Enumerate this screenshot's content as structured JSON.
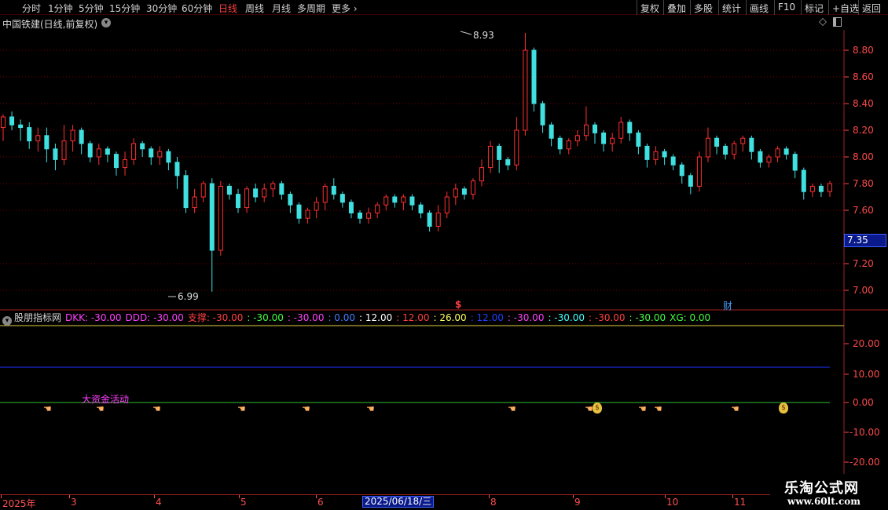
{
  "toolbar": {
    "periods": [
      "分时",
      "1分钟",
      "5分钟",
      "15分钟",
      "30分钟",
      "60分钟",
      "日线",
      "周线",
      "月线",
      "多周期",
      "更多"
    ],
    "active_period": "日线",
    "right_buttons": [
      "复权",
      "叠加",
      "多股",
      "统计",
      "画线",
      "F10",
      "标记",
      "+自选",
      "返回"
    ]
  },
  "stock": {
    "title": "中国铁建(日线,前复权)"
  },
  "price_axis": {
    "ticks": [
      "8.80",
      "8.60",
      "8.40",
      "8.20",
      "8.00",
      "7.80",
      "7.60",
      "7.20",
      "7.00"
    ],
    "current_price": "7.35"
  },
  "annotations": {
    "high": "8.93",
    "low": "6.99",
    "marker_dollar": "$",
    "marker_cai": "财",
    "big_money": "大资金活动"
  },
  "indicator": {
    "name": "股朋指标网",
    "items": [
      {
        "text": "DKK: -30.00",
        "color": "#ff40ff"
      },
      {
        "text": "DDD: -30.00",
        "color": "#ff40ff"
      },
      {
        "text": "支撑: -30.00",
        "color": "#ff4040"
      },
      {
        "text": ": -30.00",
        "color": "#40ff40"
      },
      {
        "text": ": -30.00",
        "color": "#ff40ff"
      },
      {
        "text": ": 0.00",
        "color": "#4080ff"
      },
      {
        "text": ": 12.00",
        "color": "#ffffff"
      },
      {
        "text": ": 12.00",
        "color": "#ff4040"
      },
      {
        "text": ": 26.00",
        "color": "#ffff60"
      },
      {
        "text": ": 12.00",
        "color": "#2040ff"
      },
      {
        "text": ": -30.00",
        "color": "#ff40ff"
      },
      {
        "text": ": -30.00",
        "color": "#40ffff"
      },
      {
        "text": ": -30.00",
        "color": "#ff4040"
      },
      {
        "text": ": -30.00",
        "color": "#40ff40"
      },
      {
        "text": "XG: 0.00",
        "color": "#40ff40"
      }
    ],
    "axis_ticks": [
      "20.00",
      "10.00",
      "0.00",
      "-10.00",
      "-20.00"
    ]
  },
  "date_axis": {
    "labels": [
      "2025年",
      "3",
      "4",
      "5",
      "6",
      "8",
      "9",
      "10",
      "11"
    ],
    "selected": "2025/06/18/三"
  },
  "watermark": {
    "title": "乐淘公式网",
    "url": "www.60lt.com"
  },
  "colors": {
    "up": "#ff3030",
    "down": "#40e0e0",
    "grid": "#7a0000",
    "axis": "#ff4a4a",
    "line_yellow": "#e0d040",
    "line_blue": "#2030ff",
    "line_green": "#30c030"
  },
  "chart_data": {
    "type": "candlestick",
    "ylim": [
      6.9,
      9.0
    ],
    "points": [
      [
        8.22,
        8.3,
        8.2,
        8.32,
        8.12
      ],
      [
        8.3,
        8.24,
        8.2,
        8.34,
        8.2
      ],
      [
        8.24,
        8.22,
        8.16,
        8.28,
        8.12
      ],
      [
        8.22,
        8.12,
        8.1,
        8.26,
        8.06
      ],
      [
        8.12,
        8.16,
        8.08,
        8.22,
        8.04
      ],
      [
        8.16,
        8.06,
        8.0,
        8.22,
        7.96
      ],
      [
        8.06,
        7.98,
        7.92,
        8.1,
        7.9
      ],
      [
        7.98,
        8.12,
        8.0,
        8.24,
        7.94
      ],
      [
        8.12,
        8.2,
        8.06,
        8.24,
        8.04
      ],
      [
        8.2,
        8.1,
        8.06,
        8.22,
        8.02
      ],
      [
        8.1,
        8.0,
        7.98,
        8.12,
        7.96
      ],
      [
        8.0,
        8.06,
        7.96,
        8.1,
        7.94
      ],
      [
        8.06,
        8.02,
        7.98,
        8.08,
        7.96
      ],
      [
        8.02,
        7.92,
        7.88,
        8.04,
        7.86
      ],
      [
        7.92,
        7.98,
        7.88,
        8.04,
        7.86
      ],
      [
        7.98,
        8.1,
        7.96,
        8.14,
        7.94
      ],
      [
        8.1,
        8.06,
        8.04,
        8.12,
        8.0
      ],
      [
        8.06,
        8.0,
        7.96,
        8.08,
        7.94
      ],
      [
        8.0,
        8.04,
        7.96,
        8.08,
        7.94
      ],
      [
        8.04,
        7.96,
        7.92,
        8.06,
        7.9
      ],
      [
        7.96,
        7.86,
        7.8,
        8.0,
        7.76
      ],
      [
        7.86,
        7.62,
        7.6,
        7.9,
        7.58
      ],
      [
        7.62,
        7.7,
        7.6,
        7.76,
        7.58
      ],
      [
        7.7,
        7.8,
        7.68,
        7.82,
        7.66
      ],
      [
        7.8,
        7.3,
        7.24,
        7.84,
        6.99
      ],
      [
        7.3,
        7.78,
        7.28,
        7.82,
        7.26
      ],
      [
        7.78,
        7.72,
        7.7,
        7.8,
        7.68
      ],
      [
        7.72,
        7.62,
        7.6,
        7.76,
        7.58
      ],
      [
        7.62,
        7.76,
        7.6,
        7.78,
        7.58
      ],
      [
        7.76,
        7.7,
        7.68,
        7.8,
        7.66
      ],
      [
        7.7,
        7.76,
        7.68,
        7.8,
        7.66
      ],
      [
        7.76,
        7.8,
        7.72,
        7.82,
        7.7
      ],
      [
        7.8,
        7.72,
        7.7,
        7.82,
        7.68
      ],
      [
        7.72,
        7.64,
        7.6,
        7.74,
        7.58
      ],
      [
        7.64,
        7.54,
        7.52,
        7.66,
        7.5
      ],
      [
        7.54,
        7.6,
        7.52,
        7.62,
        7.5
      ],
      [
        7.6,
        7.66,
        7.56,
        7.7,
        7.54
      ],
      [
        7.66,
        7.78,
        7.62,
        7.8,
        7.6
      ],
      [
        7.78,
        7.72,
        7.7,
        7.84,
        7.68
      ],
      [
        7.72,
        7.66,
        7.64,
        7.74,
        7.62
      ],
      [
        7.66,
        7.58,
        7.56,
        7.68,
        7.54
      ],
      [
        7.58,
        7.54,
        7.52,
        7.6,
        7.5
      ],
      [
        7.54,
        7.58,
        7.52,
        7.62,
        7.5
      ],
      [
        7.58,
        7.64,
        7.56,
        7.66,
        7.54
      ],
      [
        7.64,
        7.7,
        7.62,
        7.72,
        7.6
      ],
      [
        7.7,
        7.66,
        7.64,
        7.72,
        7.62
      ],
      [
        7.66,
        7.7,
        7.62,
        7.72,
        7.6
      ],
      [
        7.7,
        7.64,
        7.62,
        7.72,
        7.6
      ],
      [
        7.64,
        7.58,
        7.56,
        7.66,
        7.54
      ],
      [
        7.58,
        7.48,
        7.46,
        7.6,
        7.44
      ],
      [
        7.48,
        7.58,
        7.46,
        7.64,
        7.44
      ],
      [
        7.58,
        7.7,
        7.56,
        7.74,
        7.54
      ],
      [
        7.7,
        7.76,
        7.66,
        7.8,
        7.64
      ],
      [
        7.76,
        7.72,
        7.7,
        7.78,
        7.68
      ],
      [
        7.72,
        7.82,
        7.7,
        7.84,
        7.68
      ],
      [
        7.82,
        7.92,
        7.8,
        7.98,
        7.78
      ],
      [
        7.92,
        8.08,
        7.9,
        8.12,
        7.88
      ],
      [
        8.08,
        7.98,
        7.92,
        8.1,
        7.88
      ],
      [
        7.98,
        7.94,
        7.92,
        8.0,
        7.9
      ],
      [
        7.94,
        8.2,
        7.92,
        8.3,
        7.9
      ],
      [
        8.2,
        8.8,
        8.18,
        8.93,
        8.16
      ],
      [
        8.8,
        8.4,
        8.36,
        8.82,
        8.34
      ],
      [
        8.4,
        8.24,
        8.2,
        8.42,
        8.18
      ],
      [
        8.24,
        8.14,
        8.1,
        8.26,
        8.08
      ],
      [
        8.14,
        8.06,
        8.04,
        8.16,
        8.02
      ],
      [
        8.06,
        8.12,
        8.04,
        8.14,
        8.02
      ],
      [
        8.12,
        8.16,
        8.1,
        8.2,
        8.08
      ],
      [
        8.16,
        8.24,
        8.14,
        8.38,
        8.12
      ],
      [
        8.24,
        8.18,
        8.12,
        8.26,
        8.1
      ],
      [
        8.18,
        8.1,
        8.06,
        8.2,
        8.04
      ],
      [
        8.1,
        8.14,
        8.06,
        8.18,
        8.04
      ],
      [
        8.14,
        8.26,
        8.12,
        8.3,
        8.1
      ],
      [
        8.26,
        8.18,
        8.14,
        8.28,
        8.12
      ],
      [
        8.18,
        8.08,
        8.04,
        8.2,
        8.02
      ],
      [
        8.08,
        7.98,
        7.94,
        8.1,
        7.92
      ],
      [
        7.98,
        8.04,
        7.96,
        8.08,
        7.94
      ],
      [
        8.04,
        8.0,
        7.96,
        8.06,
        7.94
      ],
      [
        8.0,
        7.94,
        7.92,
        8.02,
        7.9
      ],
      [
        7.94,
        7.86,
        7.82,
        7.96,
        7.8
      ],
      [
        7.86,
        7.78,
        7.74,
        7.88,
        7.72
      ],
      [
        7.78,
        8.0,
        7.76,
        8.04,
        7.74
      ],
      [
        8.0,
        8.14,
        7.98,
        8.22,
        7.96
      ],
      [
        8.14,
        8.08,
        8.04,
        8.16,
        8.02
      ],
      [
        8.08,
        8.02,
        8.0,
        8.1,
        7.98
      ],
      [
        8.02,
        8.1,
        8.0,
        8.12,
        7.98
      ],
      [
        8.1,
        8.14,
        8.06,
        8.16,
        8.04
      ],
      [
        8.14,
        8.04,
        8.0,
        8.16,
        7.98
      ],
      [
        8.04,
        7.96,
        7.94,
        8.06,
        7.92
      ],
      [
        7.96,
        8.0,
        7.94,
        8.02,
        7.92
      ],
      [
        8.0,
        8.06,
        7.98,
        8.08,
        7.96
      ],
      [
        8.06,
        8.02,
        8.0,
        8.08,
        7.98
      ],
      [
        8.02,
        7.9,
        7.86,
        8.04,
        7.84
      ],
      [
        7.9,
        7.74,
        7.7,
        7.92,
        7.68
      ],
      [
        7.74,
        7.78,
        7.72,
        7.8,
        7.7
      ],
      [
        7.78,
        7.74,
        7.72,
        7.8,
        7.7
      ],
      [
        7.74,
        7.8,
        7.72,
        7.82,
        7.7
      ]
    ]
  }
}
